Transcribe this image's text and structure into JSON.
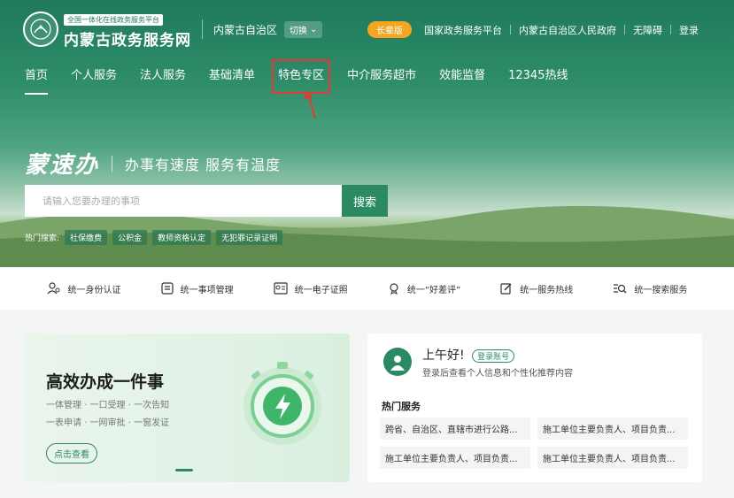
{
  "header": {
    "logo_sub": "全国一体化在线政务服务平台",
    "logo_main": "内蒙古政务服务网",
    "region": "内蒙古自治区",
    "switch_label": "切换",
    "elder_label": "长辈版",
    "links": [
      "国家政务服务平台",
      "内蒙古自治区人民政府",
      "无障碍",
      "登录"
    ]
  },
  "nav": {
    "items": [
      "首页",
      "个人服务",
      "法人服务",
      "基础清单",
      "特色专区",
      "中介服务超市",
      "效能监督",
      "12345热线"
    ],
    "active_index": 0,
    "highlighted_index": 4
  },
  "hero": {
    "brand": "蒙速办",
    "slogan": "办事有速度  服务有温度",
    "search_placeholder": "请输入您要办理的事项",
    "search_button": "搜索",
    "hot_label": "热门搜索:",
    "hot_tags": [
      "社保缴费",
      "公积金",
      "教师资格认定",
      "无犯罪记录证明"
    ]
  },
  "services": [
    {
      "icon": "identity-auth-icon",
      "label": "统一身份认证"
    },
    {
      "icon": "item-management-icon",
      "label": "统一事项管理"
    },
    {
      "icon": "e-certificate-icon",
      "label": "统一电子证照"
    },
    {
      "icon": "evaluation-icon",
      "label": "统一“好差评”"
    },
    {
      "icon": "hotline-icon",
      "label": "统一服务热线"
    },
    {
      "icon": "search-service-icon",
      "label": "统一搜索服务"
    }
  ],
  "banner": {
    "title": "高效办成一件事",
    "line1": "一体管理 · 一口受理 · 一次告知",
    "line2": "一表申请 · 一网审批 · 一窗发证",
    "button": "点击查看"
  },
  "user_card": {
    "greeting": "上午好!",
    "login_tag": "登录账号",
    "subtitle": "登录后查看个人信息和个性化推荐内容",
    "hot_title": "热门服务",
    "hot_items": [
      "跨省、自治区、直辖市进行公路...",
      "施工单位主要负责人、项目负责...",
      "施工单位主要负责人、项目负责...",
      "施工单位主要负责人、项目负责..."
    ]
  },
  "colors": {
    "primary": "#2b8a62",
    "elder": "#f4a623",
    "highlight": "#e53935"
  }
}
